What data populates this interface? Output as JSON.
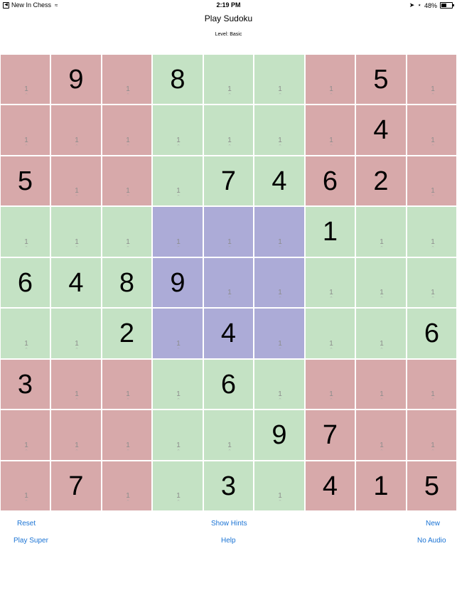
{
  "status_bar": {
    "back_app": "New In Chess",
    "time": "2:19 PM",
    "battery": "48%",
    "battery_level": 0.48
  },
  "title": "Play Sudoku",
  "level": "Level: Basic",
  "colors": {
    "red": "#d7a9aa",
    "green": "#c4e2c4",
    "blue": "#acabd7",
    "link": "#1a73d4"
  },
  "board": {
    "values": [
      [
        "",
        "9",
        "",
        "8",
        "",
        "",
        "",
        "5",
        ""
      ],
      [
        "",
        "",
        "",
        "",
        "",
        "",
        "",
        "4",
        ""
      ],
      [
        "5",
        "",
        "",
        "",
        "7",
        "4",
        "6",
        "2",
        ""
      ],
      [
        "",
        "",
        "",
        "",
        "",
        "",
        "1",
        "",
        ""
      ],
      [
        "6",
        "4",
        "8",
        "9",
        "",
        "",
        "",
        "",
        ""
      ],
      [
        "",
        "",
        "2",
        "",
        "4",
        "",
        "",
        "",
        "6"
      ],
      [
        "3",
        "",
        "",
        "",
        "6",
        "",
        "",
        "",
        ""
      ],
      [
        "",
        "",
        "",
        "",
        "",
        "9",
        "7",
        "",
        ""
      ],
      [
        "",
        "7",
        "",
        "",
        "3",
        "",
        "4",
        "1",
        "5"
      ]
    ],
    "colors": [
      [
        "red",
        "red",
        "red",
        "green",
        "green",
        "green",
        "red",
        "red",
        "red"
      ],
      [
        "red",
        "red",
        "red",
        "green",
        "green",
        "green",
        "red",
        "red",
        "red"
      ],
      [
        "red",
        "red",
        "red",
        "green",
        "green",
        "green",
        "red",
        "red",
        "red"
      ],
      [
        "green",
        "green",
        "green",
        "blue",
        "blue",
        "blue",
        "green",
        "green",
        "green"
      ],
      [
        "green",
        "green",
        "green",
        "blue",
        "blue",
        "blue",
        "green",
        "green",
        "green"
      ],
      [
        "green",
        "green",
        "green",
        "blue",
        "blue",
        "blue",
        "green",
        "green",
        "green"
      ],
      [
        "red",
        "red",
        "red",
        "green",
        "green",
        "green",
        "red",
        "red",
        "red"
      ],
      [
        "red",
        "red",
        "red",
        "green",
        "green",
        "green",
        "red",
        "red",
        "red"
      ],
      [
        "red",
        "red",
        "red",
        "green",
        "green",
        "green",
        "red",
        "red",
        "red"
      ]
    ],
    "hint_text": "1"
  },
  "actions": {
    "reset": "Reset",
    "show_hints": "Show Hints",
    "new": "New",
    "play_super": "Play Super",
    "help": "Help",
    "no_audio": "No Audio"
  }
}
